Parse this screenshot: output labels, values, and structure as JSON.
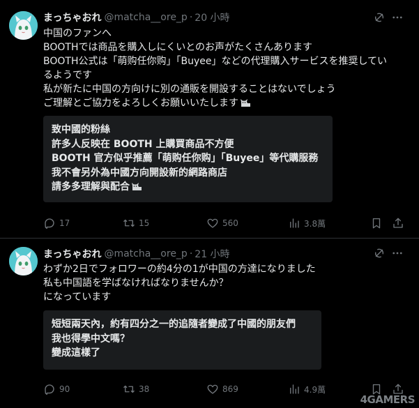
{
  "tweets": [
    {
      "author_name": "まっちゃおれ",
      "handle": "@matcha__ore_p",
      "dot": "·",
      "time": "20 小時",
      "lines": [
        "中国のファンへ",
        "BOOTHでは商品を購入しにくいとのお声がたくさんあります",
        "BOOTH公式は「萌购任你购」「Buyee」などの代理購入サービスを推奨してい",
        "るようです",
        "私が新たに中国の方向けに別の通販を開設することはないでしょう",
        "ご理解とご協力をよろしくお願いいたします"
      ],
      "translation": [
        "致中國的粉絲",
        "許多人反映在 BOOTH 上購買商品不方便",
        "BOOTH 官方似乎推薦「萌购任你购」「Buyee」等代購服務",
        "我不會另外為中國方向開設新的網路商店",
        "請多多理解與配合"
      ],
      "stats": {
        "replies": "17",
        "reposts": "15",
        "likes": "560",
        "views": "3.8萬"
      }
    },
    {
      "author_name": "まっちゃおれ",
      "handle": "@matcha__ore_p",
      "dot": "·",
      "time": "21 小時",
      "lines": [
        "わずか2日でフォロワーの約4分の1が中国の方達になりました",
        "私も中国語を学ばなければなりませんか？",
        "になっています"
      ],
      "translation": [
        "短短兩天內，約有四分之一的追隨者變成了中國的朋友們",
        "我也得學中文嗎？",
        "變成這樣了"
      ],
      "stats": {
        "replies": "90",
        "reposts": "38",
        "likes": "869",
        "views": "4.9萬"
      }
    }
  ],
  "icons": {
    "reply": "reply-icon",
    "repost": "repost-icon",
    "like": "heart-icon",
    "views": "views-icon",
    "bookmark": "bookmark-icon",
    "share": "share-icon",
    "grok": "grok-icon",
    "more": "more-icon"
  },
  "colors": {
    "background": "#000000",
    "text": "#e7e9ea",
    "muted": "#71767b",
    "translation_box": "#1a1c1e",
    "avatar": "#54c7cf"
  },
  "watermark": "4GAMERS"
}
